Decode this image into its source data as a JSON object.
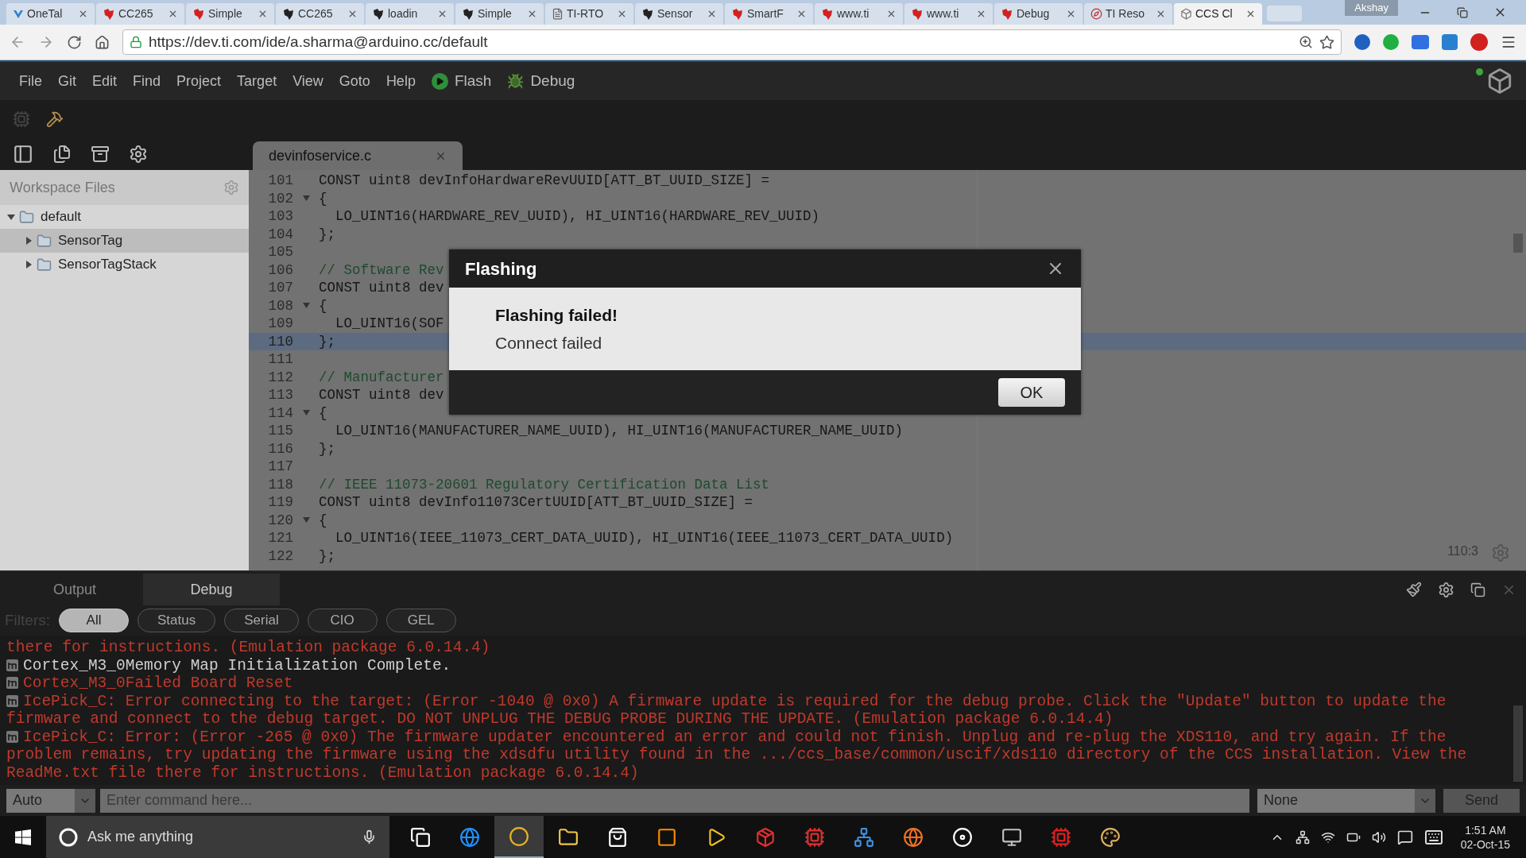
{
  "browser": {
    "tabs": [
      {
        "label": "OneTal",
        "kind": "check",
        "color": "#2f7fd0",
        "selected": false
      },
      {
        "label": "CC265",
        "kind": "logo",
        "color": "#d42020",
        "selected": false
      },
      {
        "label": "Simple",
        "kind": "logo",
        "color": "#d42020",
        "selected": false
      },
      {
        "label": "CC265",
        "kind": "logo",
        "color": "#222222",
        "selected": false
      },
      {
        "label": "loadin",
        "kind": "logo",
        "color": "#222222",
        "selected": false
      },
      {
        "label": "Simple",
        "kind": "logo",
        "color": "#222222",
        "selected": false
      },
      {
        "label": "TI-RTO",
        "kind": "doc",
        "color": "#666666",
        "selected": false
      },
      {
        "label": "Sensor",
        "kind": "logo",
        "color": "#222222",
        "selected": false
      },
      {
        "label": "SmartF",
        "kind": "logo",
        "color": "#d42020",
        "selected": false
      },
      {
        "label": "www.ti",
        "kind": "logo",
        "color": "#d42020",
        "selected": false
      },
      {
        "label": "www.ti",
        "kind": "logo",
        "color": "#d42020",
        "selected": false
      },
      {
        "label": "Debug",
        "kind": "logo",
        "color": "#d42020",
        "selected": false
      },
      {
        "label": "TI Reso",
        "kind": "compass",
        "color": "#c03030",
        "selected": false
      },
      {
        "label": "CCS Cl",
        "kind": "cube",
        "color": "#777777",
        "selected": true
      }
    ],
    "profile": "Akshay",
    "url": "https://dev.ti.com/ide/a.sharma@arduino.cc/default"
  },
  "menu": {
    "items": [
      "File",
      "Git",
      "Edit",
      "Find",
      "Project",
      "Target",
      "View",
      "Goto",
      "Help"
    ],
    "actions": [
      {
        "label": "Flash",
        "kind": "flash"
      },
      {
        "label": "Debug",
        "kind": "debug"
      }
    ]
  },
  "sidebar": {
    "title": "Workspace Files",
    "tree": [
      {
        "label": "default",
        "expanded": true,
        "selected": false,
        "children": [
          {
            "label": "SensorTag",
            "expanded": false,
            "selected": true
          },
          {
            "label": "SensorTagStack",
            "expanded": false,
            "selected": false
          }
        ]
      }
    ]
  },
  "editor": {
    "tab": "devinfoservice.c",
    "cursor": "110:3",
    "lines": [
      {
        "number": "101",
        "text": "CONST uint8 devInfoHardwareRevUUID[ATT_BT_UUID_SIZE] =",
        "kind": "code",
        "fold": false,
        "current": false
      },
      {
        "number": "102",
        "text": "{",
        "kind": "code",
        "fold": true,
        "current": false
      },
      {
        "number": "103",
        "text": "  LO_UINT16(HARDWARE_REV_UUID), HI_UINT16(HARDWARE_REV_UUID)",
        "kind": "code",
        "fold": false,
        "current": false
      },
      {
        "number": "104",
        "text": "};",
        "kind": "code",
        "fold": false,
        "current": false
      },
      {
        "number": "105",
        "kind": "code",
        "fold": false,
        "current": false
      },
      {
        "number": "106",
        "text": "// Software Rev",
        "kind": "comment",
        "fold": false,
        "current": false
      },
      {
        "number": "107",
        "text": "CONST uint8 dev",
        "kind": "code",
        "fold": false,
        "current": false
      },
      {
        "number": "108",
        "text": "{",
        "kind": "code",
        "fold": true,
        "current": false
      },
      {
        "number": "109",
        "text": "  LO_UINT16(SOF",
        "kind": "code",
        "fold": false,
        "current": false
      },
      {
        "number": "110",
        "text": "};",
        "kind": "code",
        "fold": false,
        "current": true
      },
      {
        "number": "111",
        "kind": "code",
        "fold": false,
        "current": false
      },
      {
        "number": "112",
        "text": "// Manufacturer",
        "kind": "comment",
        "fold": false,
        "current": false
      },
      {
        "number": "113",
        "text": "CONST uint8 dev",
        "kind": "code",
        "fold": false,
        "current": false
      },
      {
        "number": "114",
        "text": "{",
        "kind": "code",
        "fold": true,
        "current": false
      },
      {
        "number": "115",
        "text": "  LO_UINT16(MANUFACTURER_NAME_UUID), HI_UINT16(MANUFACTURER_NAME_UUID)",
        "kind": "code",
        "fold": false,
        "current": false
      },
      {
        "number": "116",
        "text": "};",
        "kind": "code",
        "fold": false,
        "current": false
      },
      {
        "number": "117",
        "kind": "code",
        "fold": false,
        "current": false
      },
      {
        "number": "118",
        "text": "// IEEE 11073-20601 Regulatory Certification Data List",
        "kind": "comment",
        "fold": false,
        "current": false
      },
      {
        "number": "119",
        "text": "CONST uint8 devInfo11073CertUUID[ATT_BT_UUID_SIZE] =",
        "kind": "code",
        "fold": false,
        "current": false
      },
      {
        "number": "120",
        "text": "{",
        "kind": "code",
        "fold": true,
        "current": false
      },
      {
        "number": "121",
        "text": "  LO_UINT16(IEEE_11073_CERT_DATA_UUID), HI_UINT16(IEEE_11073_CERT_DATA_UUID)",
        "kind": "code",
        "fold": false,
        "current": false
      },
      {
        "number": "122",
        "text": "};",
        "kind": "code",
        "fold": false,
        "current": false
      }
    ]
  },
  "dialog": {
    "title": "Flashing",
    "heading": "Flashing failed!",
    "message": "Connect failed",
    "button": "OK"
  },
  "console": {
    "tabs": [
      {
        "label": "Output",
        "selected": false
      },
      {
        "label": "Debug",
        "selected": true
      }
    ],
    "filters_label": "Filters:",
    "filters": [
      {
        "label": "All",
        "selected": true
      },
      {
        "label": "Status",
        "selected": false
      },
      {
        "label": "Serial",
        "selected": false
      },
      {
        "label": "CIO",
        "selected": false
      },
      {
        "label": "GEL",
        "selected": false
      }
    ],
    "log": [
      {
        "text": "there for instructions. (Emulation package 6.0.14.4)",
        "kind": "error",
        "icon": false
      },
      {
        "text": "Cortex_M3_0Memory Map Initialization Complete.",
        "kind": "info",
        "icon": true
      },
      {
        "text": "Cortex_M3_0Failed Board Reset",
        "kind": "error",
        "icon": true
      },
      {
        "text": "IcePick_C: Error connecting to the target: (Error -1040 @ 0x0) A firmware update is required for the debug probe. Click the \"Update\" button to update the firmware and connect to the debug target. DO NOT UNPLUG THE DEBUG PROBE DURING THE UPDATE. (Emulation package 6.0.14.4)",
        "kind": "error",
        "icon": true
      },
      {
        "text": "IcePick_C: Error: (Error -265 @ 0x0) The firmware updater encountered an error and could not finish. Unplug and re-plug the XDS110, and try again. If the problem remains, try updating the firmware using the xdsdfu utility found in the .../ccs_base/common/uscif/xds110 directory of the CCS installation. View the ReadMe.txt file there for instructions. (Emulation package 6.0.14.4)",
        "kind": "error",
        "icon": true
      }
    ]
  },
  "command": {
    "mode": "Auto",
    "placeholder": "Enter command here...",
    "target": "None",
    "send": "Send"
  },
  "taskbar": {
    "search": "Ask me anything",
    "apps": [
      {
        "kind": "taskview",
        "selected": false
      },
      {
        "kind": "edge",
        "selected": false
      },
      {
        "kind": "chrome",
        "selected": true
      },
      {
        "kind": "explorer",
        "selected": false
      },
      {
        "kind": "store",
        "selected": false
      },
      {
        "kind": "illustrator",
        "selected": false
      },
      {
        "kind": "media",
        "selected": false
      },
      {
        "kind": "sketch",
        "selected": false
      },
      {
        "kind": "eagle",
        "selected": false
      },
      {
        "kind": "network",
        "selected": false
      },
      {
        "kind": "firefox",
        "selected": false
      },
      {
        "kind": "disc",
        "selected": false
      },
      {
        "kind": "installer",
        "selected": false
      },
      {
        "kind": "ti",
        "selected": false
      },
      {
        "kind": "paint",
        "selected": false
      }
    ],
    "time": "1:51 AM",
    "date": "02-Oct-15"
  }
}
